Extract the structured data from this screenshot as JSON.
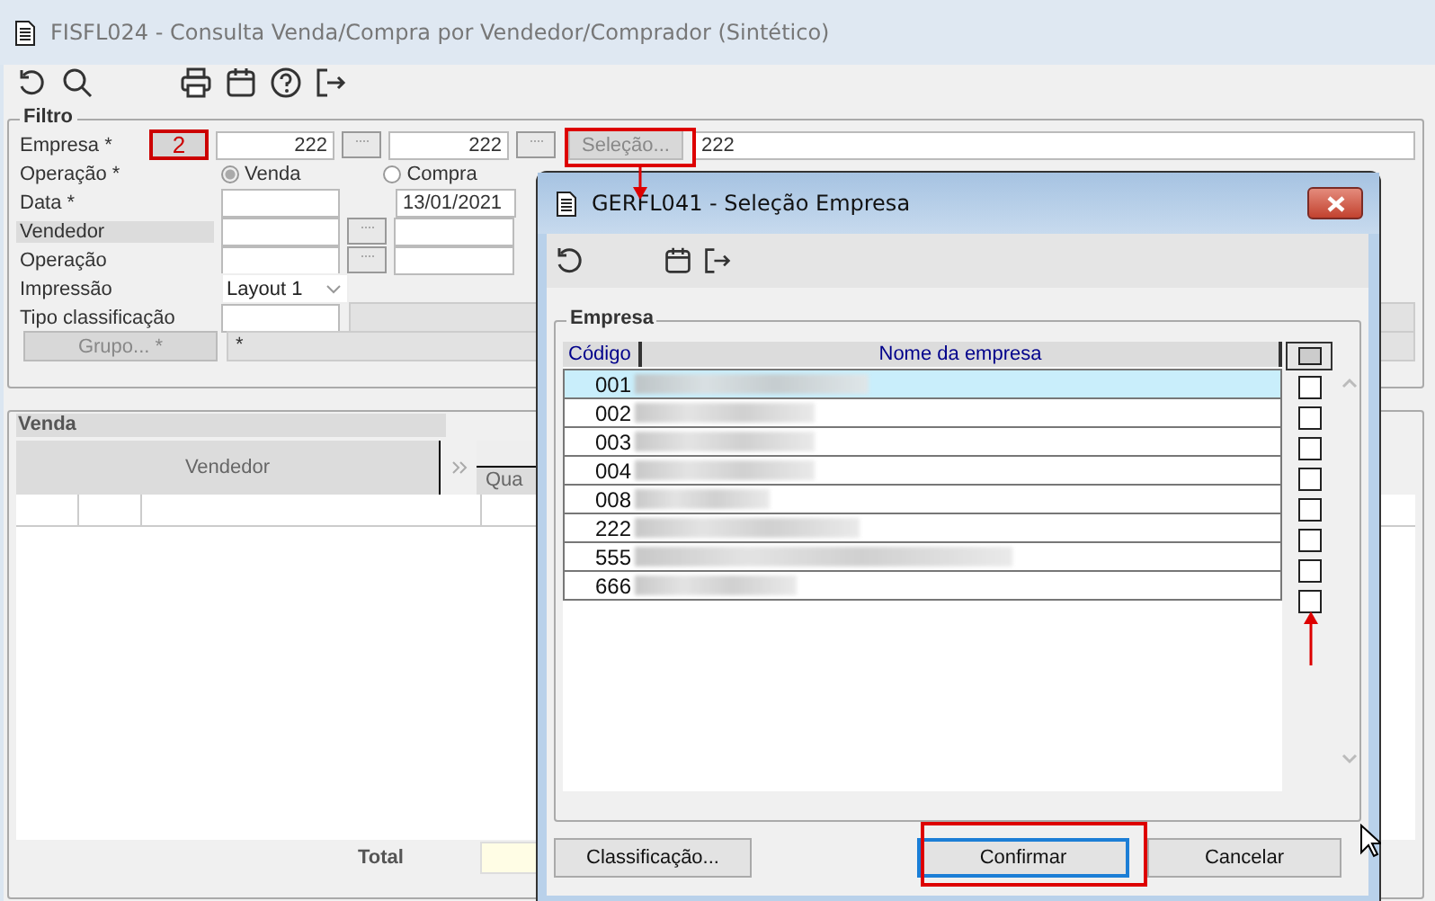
{
  "window": {
    "title": "FISFL024 - Consulta Venda/Compra por Vendedor/Comprador (Sintético)"
  },
  "filter": {
    "title": "Filtro",
    "empresa": {
      "label": "Empresa *",
      "code": "2",
      "from": "222",
      "to": "222",
      "button": "Seleção...",
      "selection": "222"
    },
    "operacao": {
      "label": "Operação *",
      "options": [
        {
          "label": "Venda",
          "selected": true
        },
        {
          "label": "Compra",
          "selected": false
        }
      ]
    },
    "data": {
      "label": "Data *",
      "to": "13/01/2021"
    },
    "vendedor": {
      "label": "Vendedor"
    },
    "operacao2": {
      "label": "Operação"
    },
    "impressao": {
      "label": "Impressão",
      "value": "Layout 1"
    },
    "tipo": {
      "label": "Tipo classificação"
    },
    "grupo": {
      "button": "Grupo... *",
      "value": "*"
    }
  },
  "sales": {
    "title": "Venda",
    "columns": [
      "Vendedor",
      "Qua"
    ],
    "total_label": "Total"
  },
  "dialog": {
    "title": "GERFL041 - Seleção Empresa",
    "group": "Empresa",
    "columns": [
      "Código",
      "Nome da empresa"
    ],
    "all_checked": false,
    "rows": [
      {
        "code": "001",
        "selected": true,
        "checked": false
      },
      {
        "code": "002",
        "selected": false,
        "checked": false
      },
      {
        "code": "003",
        "selected": false,
        "checked": false
      },
      {
        "code": "004",
        "selected": false,
        "checked": false
      },
      {
        "code": "008",
        "selected": false,
        "checked": false
      },
      {
        "code": "222",
        "selected": false,
        "checked": false
      },
      {
        "code": "555",
        "selected": false,
        "checked": false
      },
      {
        "code": "666",
        "selected": false,
        "checked": false
      }
    ],
    "buttons": [
      {
        "label": "Classificação...",
        "default": false
      },
      {
        "label": "Confirmar",
        "default": true
      },
      {
        "label": "Cancelar",
        "default": false
      }
    ]
  }
}
